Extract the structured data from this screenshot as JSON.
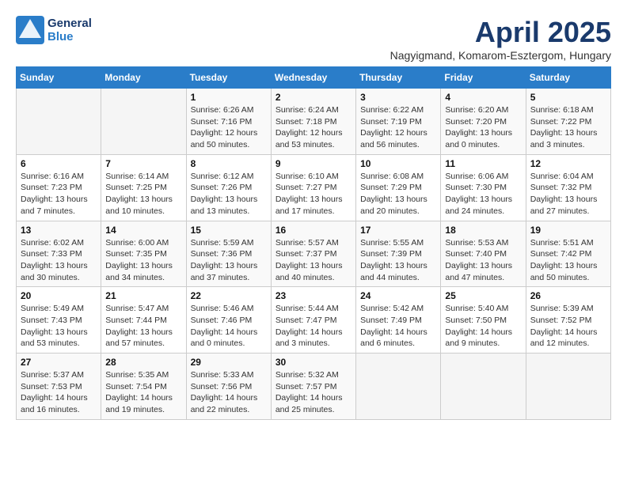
{
  "header": {
    "logo_general": "General",
    "logo_blue": "Blue",
    "month_title": "April 2025",
    "location": "Nagyigmand, Komarom-Esztergom, Hungary"
  },
  "calendar": {
    "columns": [
      "Sunday",
      "Monday",
      "Tuesday",
      "Wednesday",
      "Thursday",
      "Friday",
      "Saturday"
    ],
    "weeks": [
      [
        {
          "day": "",
          "info": ""
        },
        {
          "day": "",
          "info": ""
        },
        {
          "day": "1",
          "info": "Sunrise: 6:26 AM\nSunset: 7:16 PM\nDaylight: 12 hours and 50 minutes."
        },
        {
          "day": "2",
          "info": "Sunrise: 6:24 AM\nSunset: 7:18 PM\nDaylight: 12 hours and 53 minutes."
        },
        {
          "day": "3",
          "info": "Sunrise: 6:22 AM\nSunset: 7:19 PM\nDaylight: 12 hours and 56 minutes."
        },
        {
          "day": "4",
          "info": "Sunrise: 6:20 AM\nSunset: 7:20 PM\nDaylight: 13 hours and 0 minutes."
        },
        {
          "day": "5",
          "info": "Sunrise: 6:18 AM\nSunset: 7:22 PM\nDaylight: 13 hours and 3 minutes."
        }
      ],
      [
        {
          "day": "6",
          "info": "Sunrise: 6:16 AM\nSunset: 7:23 PM\nDaylight: 13 hours and 7 minutes."
        },
        {
          "day": "7",
          "info": "Sunrise: 6:14 AM\nSunset: 7:25 PM\nDaylight: 13 hours and 10 minutes."
        },
        {
          "day": "8",
          "info": "Sunrise: 6:12 AM\nSunset: 7:26 PM\nDaylight: 13 hours and 13 minutes."
        },
        {
          "day": "9",
          "info": "Sunrise: 6:10 AM\nSunset: 7:27 PM\nDaylight: 13 hours and 17 minutes."
        },
        {
          "day": "10",
          "info": "Sunrise: 6:08 AM\nSunset: 7:29 PM\nDaylight: 13 hours and 20 minutes."
        },
        {
          "day": "11",
          "info": "Sunrise: 6:06 AM\nSunset: 7:30 PM\nDaylight: 13 hours and 24 minutes."
        },
        {
          "day": "12",
          "info": "Sunrise: 6:04 AM\nSunset: 7:32 PM\nDaylight: 13 hours and 27 minutes."
        }
      ],
      [
        {
          "day": "13",
          "info": "Sunrise: 6:02 AM\nSunset: 7:33 PM\nDaylight: 13 hours and 30 minutes."
        },
        {
          "day": "14",
          "info": "Sunrise: 6:00 AM\nSunset: 7:35 PM\nDaylight: 13 hours and 34 minutes."
        },
        {
          "day": "15",
          "info": "Sunrise: 5:59 AM\nSunset: 7:36 PM\nDaylight: 13 hours and 37 minutes."
        },
        {
          "day": "16",
          "info": "Sunrise: 5:57 AM\nSunset: 7:37 PM\nDaylight: 13 hours and 40 minutes."
        },
        {
          "day": "17",
          "info": "Sunrise: 5:55 AM\nSunset: 7:39 PM\nDaylight: 13 hours and 44 minutes."
        },
        {
          "day": "18",
          "info": "Sunrise: 5:53 AM\nSunset: 7:40 PM\nDaylight: 13 hours and 47 minutes."
        },
        {
          "day": "19",
          "info": "Sunrise: 5:51 AM\nSunset: 7:42 PM\nDaylight: 13 hours and 50 minutes."
        }
      ],
      [
        {
          "day": "20",
          "info": "Sunrise: 5:49 AM\nSunset: 7:43 PM\nDaylight: 13 hours and 53 minutes."
        },
        {
          "day": "21",
          "info": "Sunrise: 5:47 AM\nSunset: 7:44 PM\nDaylight: 13 hours and 57 minutes."
        },
        {
          "day": "22",
          "info": "Sunrise: 5:46 AM\nSunset: 7:46 PM\nDaylight: 14 hours and 0 minutes."
        },
        {
          "day": "23",
          "info": "Sunrise: 5:44 AM\nSunset: 7:47 PM\nDaylight: 14 hours and 3 minutes."
        },
        {
          "day": "24",
          "info": "Sunrise: 5:42 AM\nSunset: 7:49 PM\nDaylight: 14 hours and 6 minutes."
        },
        {
          "day": "25",
          "info": "Sunrise: 5:40 AM\nSunset: 7:50 PM\nDaylight: 14 hours and 9 minutes."
        },
        {
          "day": "26",
          "info": "Sunrise: 5:39 AM\nSunset: 7:52 PM\nDaylight: 14 hours and 12 minutes."
        }
      ],
      [
        {
          "day": "27",
          "info": "Sunrise: 5:37 AM\nSunset: 7:53 PM\nDaylight: 14 hours and 16 minutes."
        },
        {
          "day": "28",
          "info": "Sunrise: 5:35 AM\nSunset: 7:54 PM\nDaylight: 14 hours and 19 minutes."
        },
        {
          "day": "29",
          "info": "Sunrise: 5:33 AM\nSunset: 7:56 PM\nDaylight: 14 hours and 22 minutes."
        },
        {
          "day": "30",
          "info": "Sunrise: 5:32 AM\nSunset: 7:57 PM\nDaylight: 14 hours and 25 minutes."
        },
        {
          "day": "",
          "info": ""
        },
        {
          "day": "",
          "info": ""
        },
        {
          "day": "",
          "info": ""
        }
      ]
    ]
  }
}
